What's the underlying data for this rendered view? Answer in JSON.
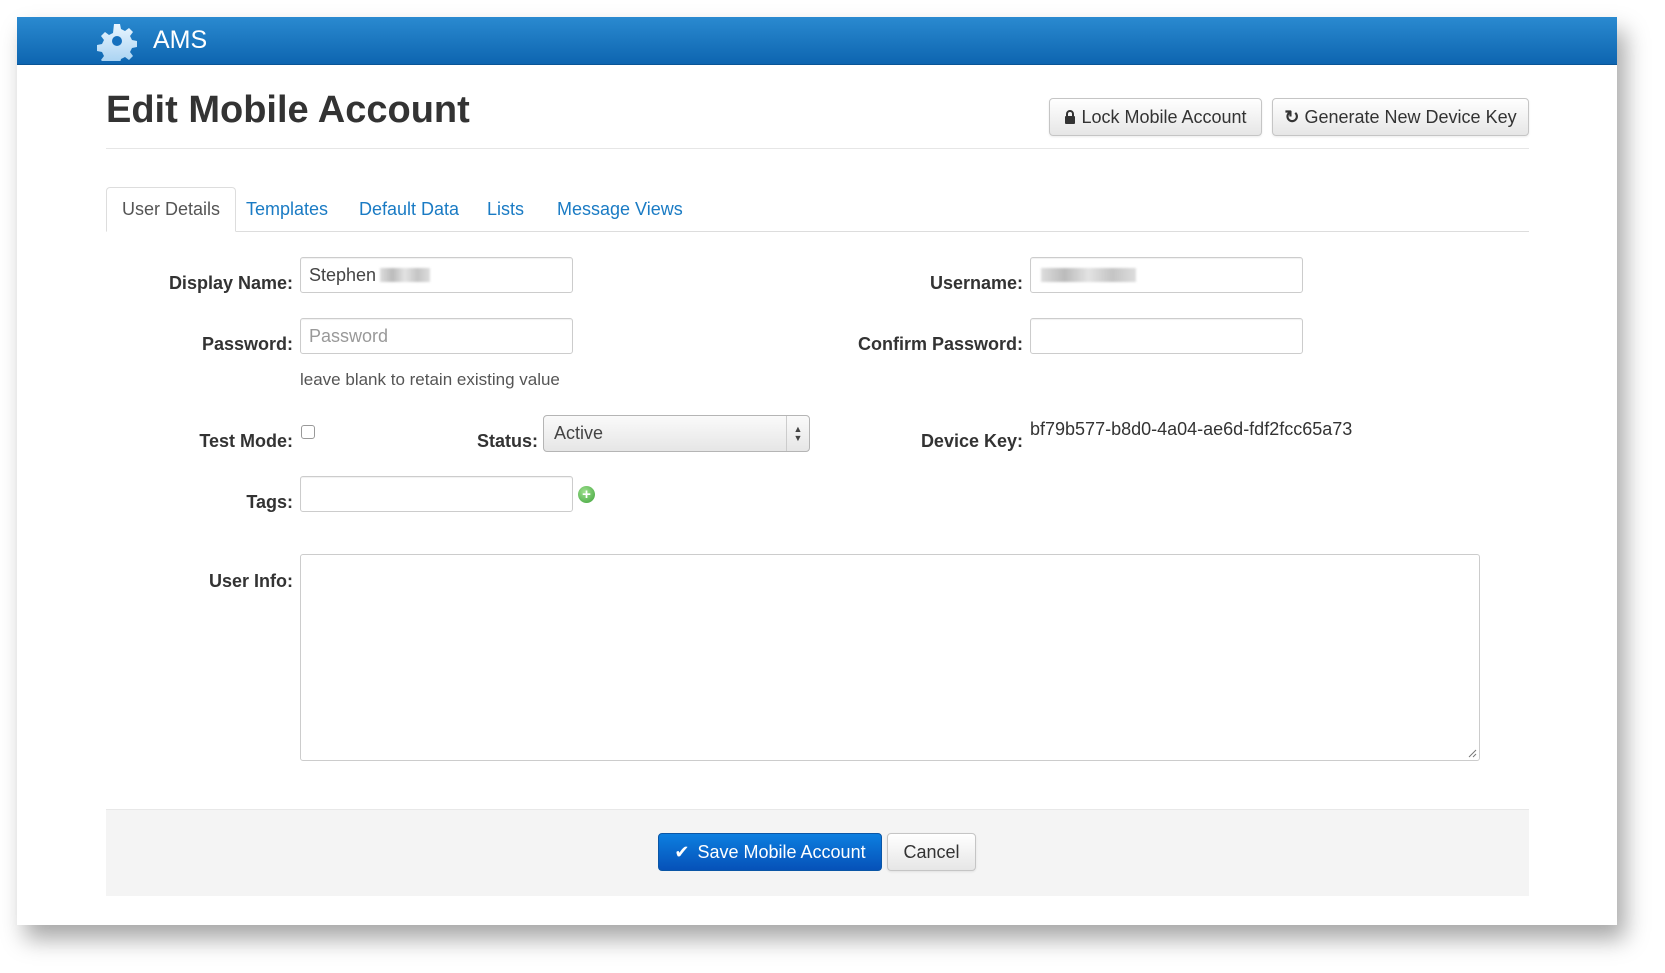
{
  "app": {
    "name": "AMS",
    "logo_icon": "gear-chat-icon"
  },
  "page": {
    "title": "Edit Mobile Account"
  },
  "actions": {
    "lock_label": "Lock Mobile Account",
    "lock_icon": "lock-icon",
    "generate_label": "Generate New Device Key",
    "generate_icon": "refresh-icon"
  },
  "tabs": [
    {
      "label": "User Details",
      "active": true
    },
    {
      "label": "Templates",
      "active": false
    },
    {
      "label": "Default Data",
      "active": false
    },
    {
      "label": "Lists",
      "active": false
    },
    {
      "label": "Message Views",
      "active": false
    }
  ],
  "form": {
    "display_name": {
      "label": "Display Name:",
      "value": "Stephen"
    },
    "username": {
      "label": "Username:",
      "value": ""
    },
    "password": {
      "label": "Password:",
      "placeholder": "Password",
      "hint": "leave blank to retain existing value"
    },
    "confirm_password": {
      "label": "Confirm Password:",
      "value": ""
    },
    "test_mode": {
      "label": "Test Mode:",
      "checked": false
    },
    "status": {
      "label": "Status:",
      "value": "Active"
    },
    "device_key": {
      "label": "Device Key:",
      "value": "bf79b577-b8d0-4a04-ae6d-fdf2fcc65a73"
    },
    "tags": {
      "label": "Tags:",
      "value": ""
    },
    "user_info": {
      "label": "User Info:",
      "value": ""
    }
  },
  "footer": {
    "save_label": "Save Mobile Account",
    "cancel_label": "Cancel"
  },
  "colors": {
    "header": "#1570bd",
    "link": "#1a7bc4",
    "primary": "#0866c6"
  }
}
